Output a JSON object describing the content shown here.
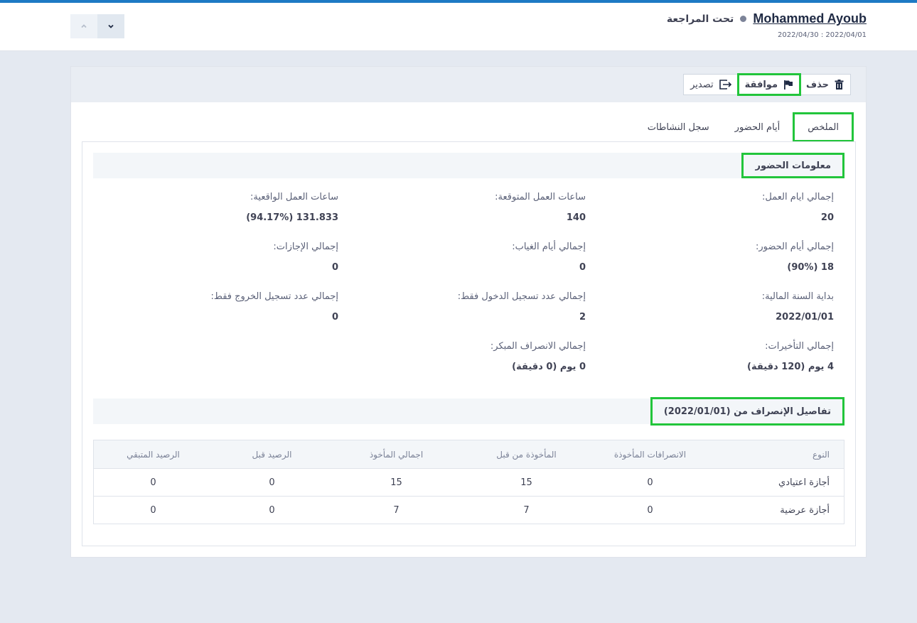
{
  "header": {
    "employee_name": "Mohammed Ayoub",
    "status": "تحت المراجعة",
    "date_range": "2022/04/30 : 2022/04/01"
  },
  "actions": {
    "delete": "حذف",
    "approve": "موافقة",
    "export": "تصدير"
  },
  "tabs": [
    "الملخص",
    "أيام الحضور",
    "سجل النشاطات"
  ],
  "attendance": {
    "title": "معلومات الحضور",
    "fields": {
      "total_work_days": {
        "label": "إجمالي ايام العمل:",
        "value": "20"
      },
      "expected_hours": {
        "label": "ساعات العمل المتوقعة:",
        "value": "140"
      },
      "actual_hours": {
        "label": "ساعات العمل الواقعية:",
        "value": "131.833 (94.17%)"
      },
      "attendance_days": {
        "label": "إجمالي أيام الحضور:",
        "value": "18 (90%)"
      },
      "absence_days": {
        "label": "إجمالي أيام الغياب:",
        "value": "0"
      },
      "total_leaves": {
        "label": "إجمالي الإجازات:",
        "value": "0"
      },
      "fiscal_year_start": {
        "label": "بداية السنة المالية:",
        "value": "2022/01/01"
      },
      "sign_in_only": {
        "label": "إجمالي عدد تسجيل الدخول فقط:",
        "value": "2"
      },
      "sign_out_only": {
        "label": "إجمالي عدد تسجيل الخروج فقط:",
        "value": "0"
      },
      "total_delays": {
        "label": "إجمالي التأخيرات:",
        "value": "4 يوم (120 دقيقة)"
      },
      "early_leave": {
        "label": "إجمالي الانصراف المبكر:",
        "value": "0 يوم (0 دقيقة)"
      }
    }
  },
  "leave_details": {
    "title": "تفاصيل الإنصراف من (2022/01/01)",
    "columns": [
      "النوع",
      "الانصرافات المأخوذة",
      "المأخوذة من قبل",
      "اجمالي المأخوذ",
      "الرصيد قبل",
      "الرصيد المتبقي"
    ],
    "rows": [
      [
        "أجازة اعتيادي",
        "0",
        "15",
        "15",
        "0",
        "0"
      ],
      [
        "أجازة عرضية",
        "0",
        "7",
        "7",
        "0",
        "0"
      ]
    ]
  },
  "icons": {
    "nav_up": "chevron-up-icon",
    "nav_down": "chevron-down-icon",
    "delete": "trash-icon",
    "approve": "flag-icon",
    "export": "export-icon"
  },
  "colors": {
    "accent_bar": "#1e7ac4",
    "highlight": "#22c53b",
    "background": "#e4e9f1"
  }
}
